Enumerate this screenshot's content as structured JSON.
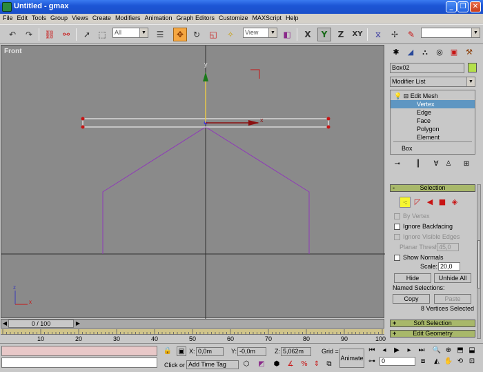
{
  "window": {
    "title": "Untitled - gmax",
    "min": "_",
    "max": "❐",
    "close": "✕"
  },
  "menu": [
    "File",
    "Edit",
    "Tools",
    "Group",
    "Views",
    "Create",
    "Modifiers",
    "Animation",
    "Graph Editors",
    "Customize",
    "MAXScript",
    "Help"
  ],
  "toolbar": {
    "filter_value": "All",
    "refcoord_value": "View",
    "axis_x": "X",
    "axis_y": "Y",
    "axis_z": "Z",
    "axis_xy": "XY"
  },
  "viewport": {
    "label": "Front",
    "axis_y_label": "y",
    "axis_x_label": "x",
    "tripod_x": "x",
    "tripod_z": "z"
  },
  "command_panel": {
    "object_name": "Box02",
    "modifier_list": "Modifier List",
    "stack": {
      "edit_mesh": "Edit Mesh",
      "levels": [
        "Vertex",
        "Edge",
        "Face",
        "Polygon",
        "Element"
      ],
      "selected_level": "Vertex",
      "base": "Box"
    },
    "selection_rollout": {
      "title": "Selection",
      "by_vertex": "By Vertex",
      "ignore_backfacing": "Ignore Backfacing",
      "ignore_visible_edges": "Ignore Visible Edges",
      "planar_thresh_label": "Planar Thresh:",
      "planar_thresh_value": "45,0",
      "show_normals": "Show Normals",
      "scale_label": "Scale:",
      "scale_value": "20,0",
      "hide": "Hide",
      "unhide_all": "Unhide All",
      "named_selections": "Named Selections:",
      "copy": "Copy",
      "paste": "Paste",
      "status": "8 Vertices Selected"
    },
    "soft_selection": "Soft Selection",
    "edit_geometry": "Edit Geometry"
  },
  "timeline": {
    "slider": "0 / 100",
    "ticks": [
      "10",
      "20",
      "30",
      "40",
      "50",
      "60",
      "70",
      "80",
      "90",
      "100"
    ]
  },
  "status": {
    "x_label": "X:",
    "x_value": "0,0m",
    "y_label": "Y:",
    "y_value": "-0,0m",
    "z_label": "Z:",
    "z_value": "5,062m",
    "grid_label": "Grid =",
    "click_text": "Click or",
    "add_time_tag": "Add Time Tag",
    "animate": "Animate",
    "frame_value": "0"
  }
}
